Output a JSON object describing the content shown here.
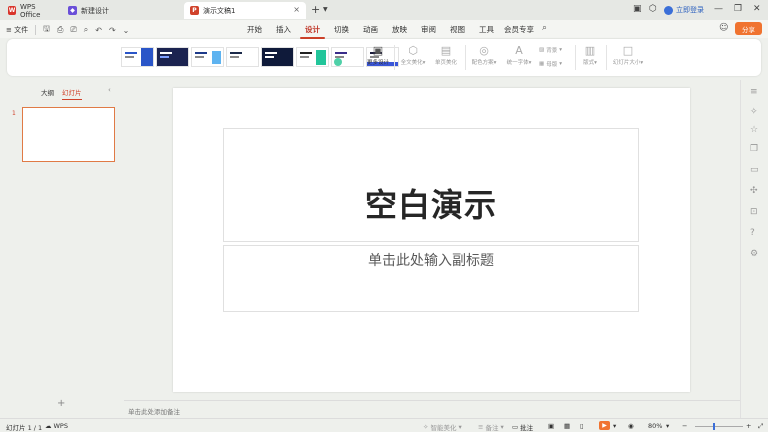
{
  "titlebar": {
    "tabs": [
      {
        "label": "WPS Office",
        "icon": "wps-logo-icon",
        "color": "#d9342b"
      },
      {
        "label": "新建设计",
        "icon": "design-icon",
        "color": "#6a4fd8"
      },
      {
        "label": "演示文稿1",
        "icon": "presentation-icon",
        "color": "#d0422b"
      }
    ],
    "login_label": "立即登录"
  },
  "menubar": {
    "file_label": "文件",
    "tabs": [
      "开始",
      "插入",
      "设计",
      "切换",
      "动画",
      "放映",
      "审阅",
      "视图",
      "工具",
      "会员专享"
    ],
    "active_tab": "设计",
    "share_label": "分享"
  },
  "ribbon": {
    "more_design": "更多设计",
    "full_beautify": "全文美化",
    "single_beautify": "单页美化",
    "color_scheme": "配色方案",
    "unify_font": "统一字体",
    "background": "背景",
    "master": "母版",
    "format": "版式",
    "slide_size": "幻灯片大小"
  },
  "leftpanel": {
    "tab_outline": "大纲",
    "tab_slides": "幻灯片",
    "slide_number": "1"
  },
  "slide": {
    "title": "空白演示",
    "subtitle": "单击此处输入副标题"
  },
  "notes": {
    "placeholder": "单击此处添加备注"
  },
  "statusbar": {
    "slide_info": "幻灯片 1 / 1",
    "wps_label": "WPS",
    "smart_beautify": "智能美化",
    "notes": "备注",
    "comments": "批注",
    "zoom": "80%"
  },
  "colors": {
    "accent": "#d0422b",
    "share": "#f07330"
  }
}
